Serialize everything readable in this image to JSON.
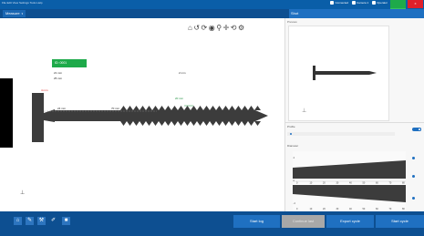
{
  "titlebar": {
    "menu_text": "File  Edit  View  Settings  Tools  Help",
    "status_items": [
      "Connected",
      "Camera 1",
      "Operator"
    ],
    "close_label": "X"
  },
  "nav": {
    "selector_label": "Measure",
    "tab_label": "Shot"
  },
  "toolbar": {
    "icons": [
      "home-icon",
      "rotate-icon",
      "refresh-icon",
      "view-icon",
      "zoom-icon",
      "crosshair-icon",
      "reset-icon",
      "settings-icon"
    ]
  },
  "canvas": {
    "label_box": "ID: 0001",
    "measurements": [
      {
        "text": "21 mm",
        "tone": "dark"
      },
      {
        "text": "25 mm",
        "tone": "dark"
      },
      {
        "text": "4 mm",
        "tone": "red"
      },
      {
        "text": "2 mm",
        "tone": "dark"
      },
      {
        "text": "24 mm",
        "tone": "dark"
      },
      {
        "text": "70 mm",
        "tone": "dark"
      },
      {
        "text": "20 mm",
        "tone": "green"
      }
    ]
  },
  "panel": {
    "thumb_header": "Preview",
    "profile_label": "Profile",
    "graph_label": "Diameter",
    "graph_ticks": [
      "0",
      "10",
      "20",
      "30",
      "40",
      "50",
      "60",
      "70",
      "80"
    ],
    "graph_yticks": [
      "4",
      "0",
      "-4"
    ]
  },
  "footer": {
    "icons": [
      "home-icon",
      "edit-icon",
      "tools-icon",
      "pen-icon",
      "stop-icon"
    ],
    "buttons": [
      {
        "label": "Start log",
        "disabled": false
      },
      {
        "label": "Continue last",
        "disabled": true
      },
      {
        "label": "Export cycle",
        "disabled": false
      },
      {
        "label": "Start cycle",
        "disabled": false
      }
    ]
  },
  "colors": {
    "primary": "#0d4f91",
    "accent": "#1f70c1",
    "success": "#1eaa4a",
    "danger": "#e0202a",
    "part": "#3c3c3c"
  }
}
